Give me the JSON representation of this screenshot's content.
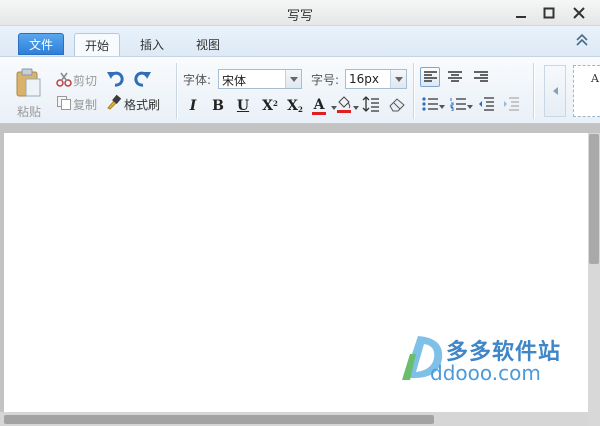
{
  "window": {
    "title": "写写"
  },
  "tabs": {
    "file": "文件",
    "home": "开始",
    "insert": "插入",
    "view": "视图"
  },
  "ribbon": {
    "paste": "粘贴",
    "cut": "剪切",
    "copy": "复制",
    "format_painter": "格式刷",
    "font_label": "字体:",
    "font_value": "宋体",
    "size_label": "字号:",
    "size_value": "16px",
    "bold": "B",
    "italic": "I",
    "underline": "U",
    "superscript": "X",
    "subscript": "X",
    "font_color": "A",
    "preview_letter": "A"
  },
  "watermark": {
    "cn": "多多软件站",
    "en": "ddooo.com"
  },
  "colors": {
    "accent": "#2d7fd9",
    "font_color_bar": "#e02020",
    "highlight_bar": "#e02020",
    "watermark": "#3f86c8"
  }
}
